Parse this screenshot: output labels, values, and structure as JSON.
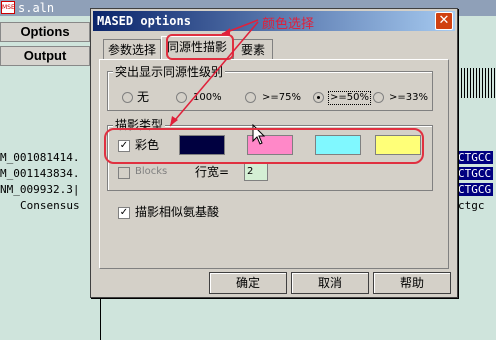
{
  "background": {
    "title": "s.aln",
    "buttons": [
      "Options",
      "Output"
    ],
    "sequence_names": [
      "M_001081414.",
      "M_001143834.",
      "NM_009932.3|",
      "Consensus"
    ],
    "right_sequences": [
      "CTGCC",
      "CTGCC",
      "CTGCG",
      "ctgc"
    ]
  },
  "dialog": {
    "title": "MASED options",
    "close_glyph": "✕",
    "tabs": [
      "参数选择",
      "同源性描影",
      "要素"
    ],
    "group_title": "突出显示同源性级别",
    "levels": [
      "无",
      "100%",
      ">=75%",
      ">=50%",
      ">=33%"
    ],
    "selected_level": ">=50%",
    "shading_group_title": "描影类型",
    "color_checkbox_label": "彩色",
    "color_checked": true,
    "swatch_colors": [
      "#000040",
      "#ff88c8",
      "#80f8ff",
      "#ffff78"
    ],
    "blocks_label": "Blocks",
    "blocks_checked": false,
    "row_width_label": "行宽=",
    "row_width_value": "2",
    "similar_aa_label": "描影相似氨基酸",
    "similar_aa_checked": true,
    "buttons": {
      "ok": "确定",
      "cancel": "取消",
      "help": "帮助"
    }
  },
  "annotation": {
    "text": "颜色选择",
    "color": "#e0203a"
  }
}
